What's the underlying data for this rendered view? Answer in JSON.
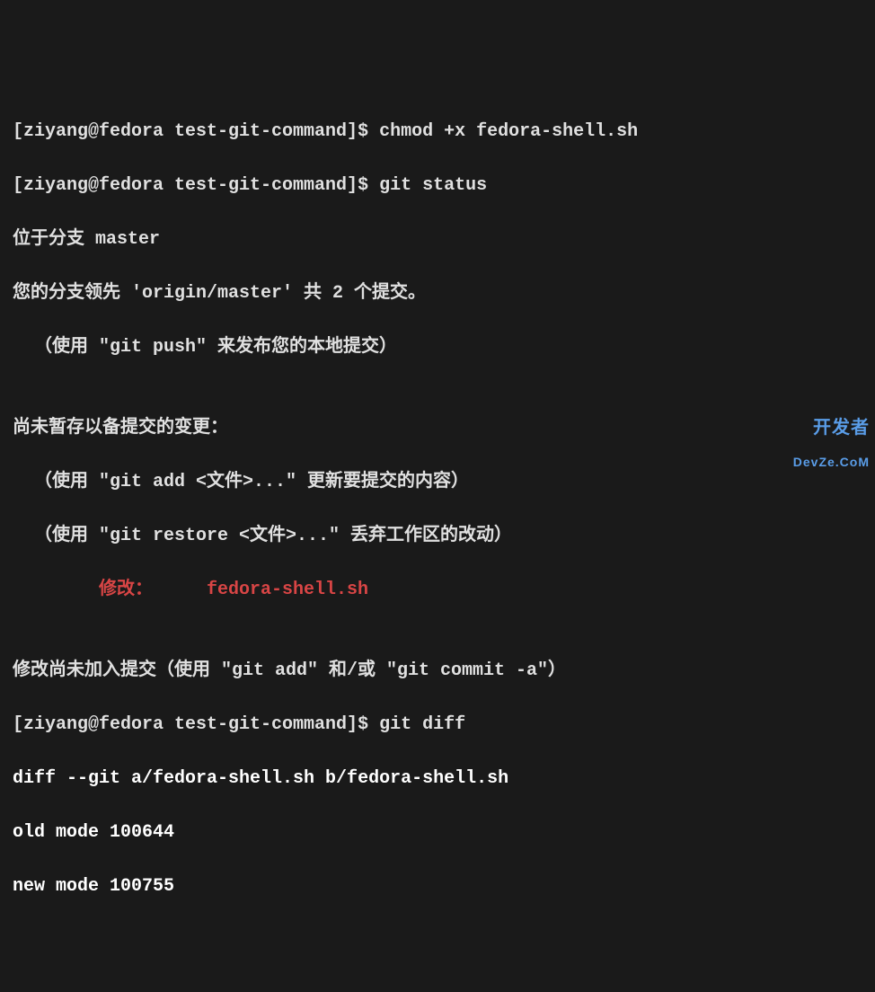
{
  "lines": {
    "l1_prompt": "[ziyang@fedora test-git-command]$ ",
    "l1_cmd": "chmod +x fedora-shell.sh",
    "l2_prompt": "[ziyang@fedora test-git-command]$ ",
    "l2_cmd": "git status",
    "l3": "位于分支 master",
    "l4": "您的分支领先 'origin/master' 共 2 个提交。",
    "l5": "  （使用 \"git push\" 来发布您的本地提交）",
    "l6": "",
    "l7": "尚未暂存以备提交的变更：",
    "l8": "  （使用 \"git add <文件>...\" 更新要提交的内容）",
    "l9": "  （使用 \"git restore <文件>...\" 丢弃工作区的改动）",
    "l10_indent": "        ",
    "l10_label": "修改：",
    "l10_spacer": "     ",
    "l10_file": "fedora-shell.sh",
    "l11": "",
    "l12": "修改尚未加入提交（使用 \"git add\" 和/或 \"git commit -a\"）",
    "l13_prompt": "[ziyang@fedora test-git-command]$ ",
    "l13_cmd": "git diff",
    "l14": "diff --git a/fedora-shell.sh b/fedora-shell.sh",
    "l15": "old mode 100644",
    "l16": "new mode 100755"
  },
  "watermark": {
    "cn": "开发者",
    "url": "DevZe.CoM"
  }
}
